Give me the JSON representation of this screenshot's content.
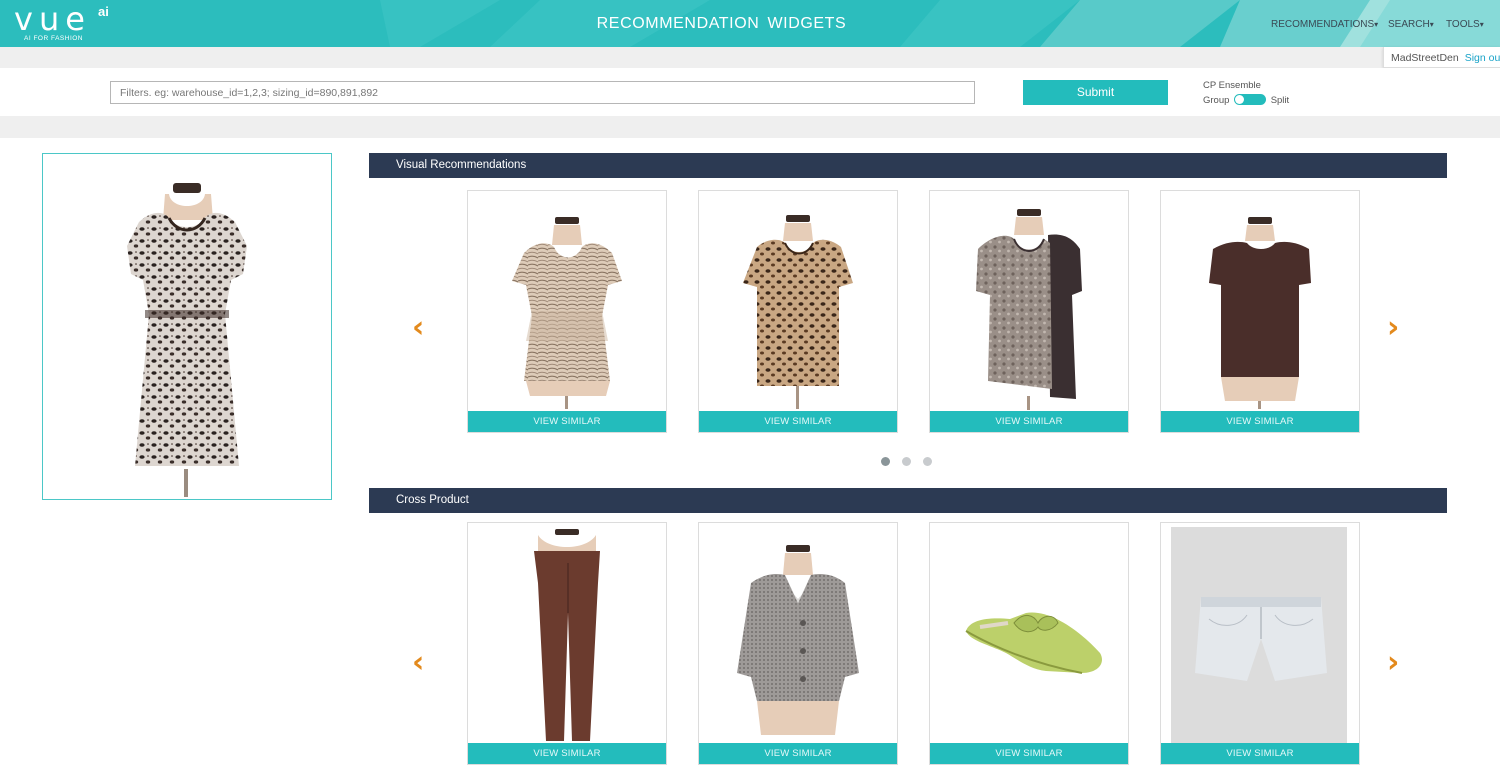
{
  "brand": {
    "name": "vue",
    "superscript": "ai",
    "tagline": "AI FOR FASHION"
  },
  "header": {
    "title": "RECOMMENDATION  WIDGETS",
    "nav": [
      {
        "label": "RECOMMENDATIONS",
        "caret": "▾"
      },
      {
        "label": "SEARCH",
        "caret": "▾"
      },
      {
        "label": "TOOLS",
        "caret": "▾"
      }
    ],
    "user": "MadStreetDen",
    "signout": "Sign out"
  },
  "filter": {
    "placeholder": "Filters. eg: warehouse_id=1,2,3; sizing_id=890,891,892",
    "submit_label": "Submit",
    "ensemble_label": "CP Ensemble",
    "toggle_left": "Group",
    "toggle_right": "Split"
  },
  "main_product": {
    "icon": "leopard-print-peplum-top-image"
  },
  "visual_recommendations": {
    "title": "Visual Recommendations",
    "prev_icon": "‹",
    "next_icon": "›",
    "items": [
      {
        "image": "beige-zebra-print-blouse",
        "button": "VIEW SIMILAR"
      },
      {
        "image": "leopard-print-tee",
        "button": "VIEW SIMILAR"
      },
      {
        "image": "snake-print-hi-lo-top",
        "button": "VIEW SIMILAR"
      },
      {
        "image": "brown-boxy-tee",
        "button": "VIEW SIMILAR"
      }
    ],
    "pages": 3,
    "active_page": 1
  },
  "cross_product": {
    "title": "Cross Product",
    "prev_icon": "‹",
    "next_icon": "›",
    "items": [
      {
        "image": "brown-skinny-pants",
        "button": "VIEW SIMILAR"
      },
      {
        "image": "grey-tweed-jacket",
        "button": "VIEW SIMILAR"
      },
      {
        "image": "lime-green-bow-mule",
        "button": "VIEW SIMILAR"
      },
      {
        "image": "light-denim-shorts",
        "button": "VIEW SIMILAR"
      }
    ]
  },
  "colors": {
    "teal": "#2cbdbd",
    "navy": "#2c3a53",
    "arrow": "#e38a1d"
  }
}
